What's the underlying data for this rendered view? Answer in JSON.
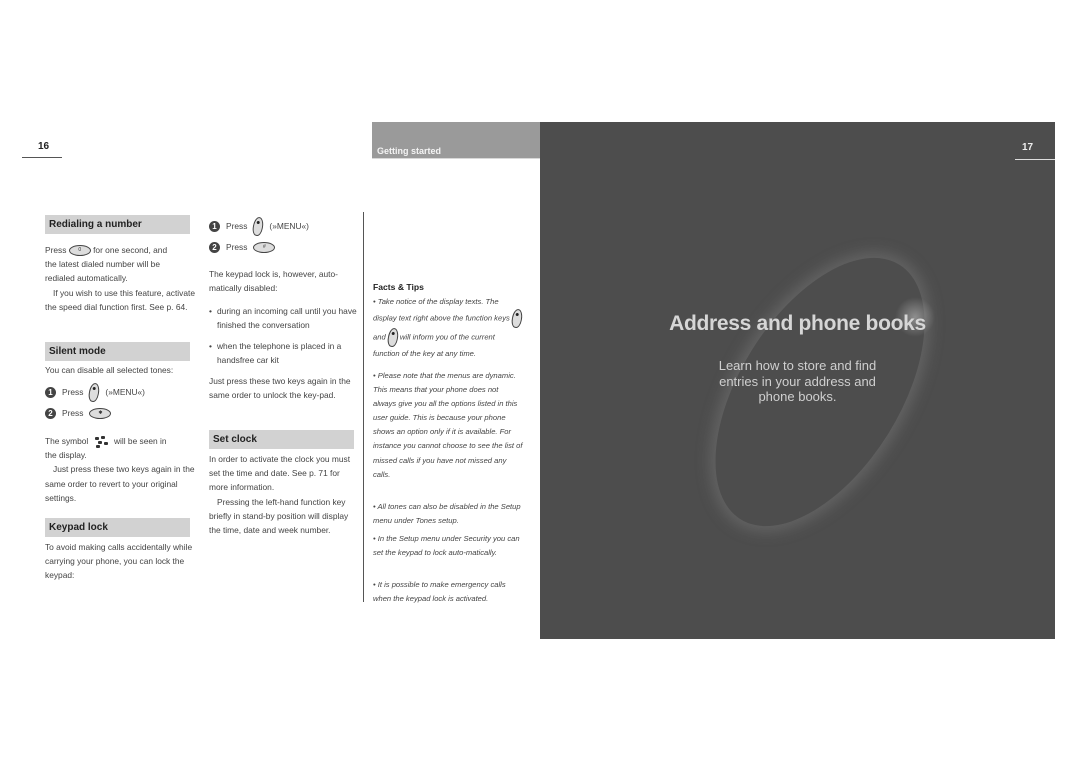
{
  "left_page": {
    "page_number": "16",
    "redialing": {
      "heading": "Redialing a number",
      "press": "Press",
      "line1_rest": "for one second, and",
      "line2": "the latest dialed number will be",
      "line3": "redialed automatically.",
      "para2": "If you wish to use this feature, activate the speed dial function first. See p. 64."
    },
    "silent": {
      "heading": "Silent mode",
      "intro": "You can disable all selected tones:",
      "step1_num": "1",
      "step1_text": "Press",
      "step1_label": "(»MENU«)",
      "step2_num": "2",
      "step2_text": "Press",
      "symbol_before": "The symbol",
      "symbol_after": "will be seen in",
      "symbol_line2": "the display.",
      "revert": "Just press these two keys again in the same order to revert to your original settings."
    },
    "keypad": {
      "heading": "Keypad lock",
      "intro": "To avoid making calls accidentally while carrying your phone, you can lock the keypad:"
    }
  },
  "middle_column": {
    "step1_num": "1",
    "step1_text": "Press",
    "step1_label": "(»MENU«)",
    "step2_num": "2",
    "step2_text": "Press",
    "auto_disabled": "The keypad lock is, however, auto-matically disabled:",
    "bullets": [
      "during an incoming call until you have finished the conversation",
      "when the telephone is placed in a handsfree car kit"
    ],
    "unlock": "Just press these two keys again in the same order to unlock the key-pad.",
    "set_clock": {
      "heading": "Set clock",
      "para1": "In order to activate the clock you must set the time and date. See p. 71 for more information.",
      "para2": "Pressing the left-hand function key briefly in stand-by position will display the time, date and week number."
    }
  },
  "tips_column": {
    "section_label": "Getting started",
    "facts_title": "Facts & Tips",
    "tip1_a": "• Take notice of the display texts. The display text right above the function",
    "tip1_keys": "keys",
    "tip1_and": "and",
    "tip1_b": "will inform you of the current function of the key at any time.",
    "tips": [
      "• Please note that the menus are dynamic. This means that your phone does not always give you all the options listed in this user guide. This is because your phone shows an option only if it is available. For instance you cannot choose to see the list of missed calls if you have not missed any calls.",
      "• All tones can also be disabled in the Setup menu under Tones setup.",
      "• In the Setup menu under Security you can set the keypad to lock auto-matically.",
      "• It is possible to make emergency calls when the keypad lock is activated."
    ]
  },
  "right_page": {
    "page_number": "17",
    "title": "Address and phone books",
    "subtitle_lines": [
      "Learn how to store and find",
      "entries in your address and",
      "phone books."
    ]
  },
  "colors": {
    "section_bar": "#d2d2d2",
    "getting_started_bar": "#9a9a9a",
    "dark_panel": "#4d4d4d"
  }
}
